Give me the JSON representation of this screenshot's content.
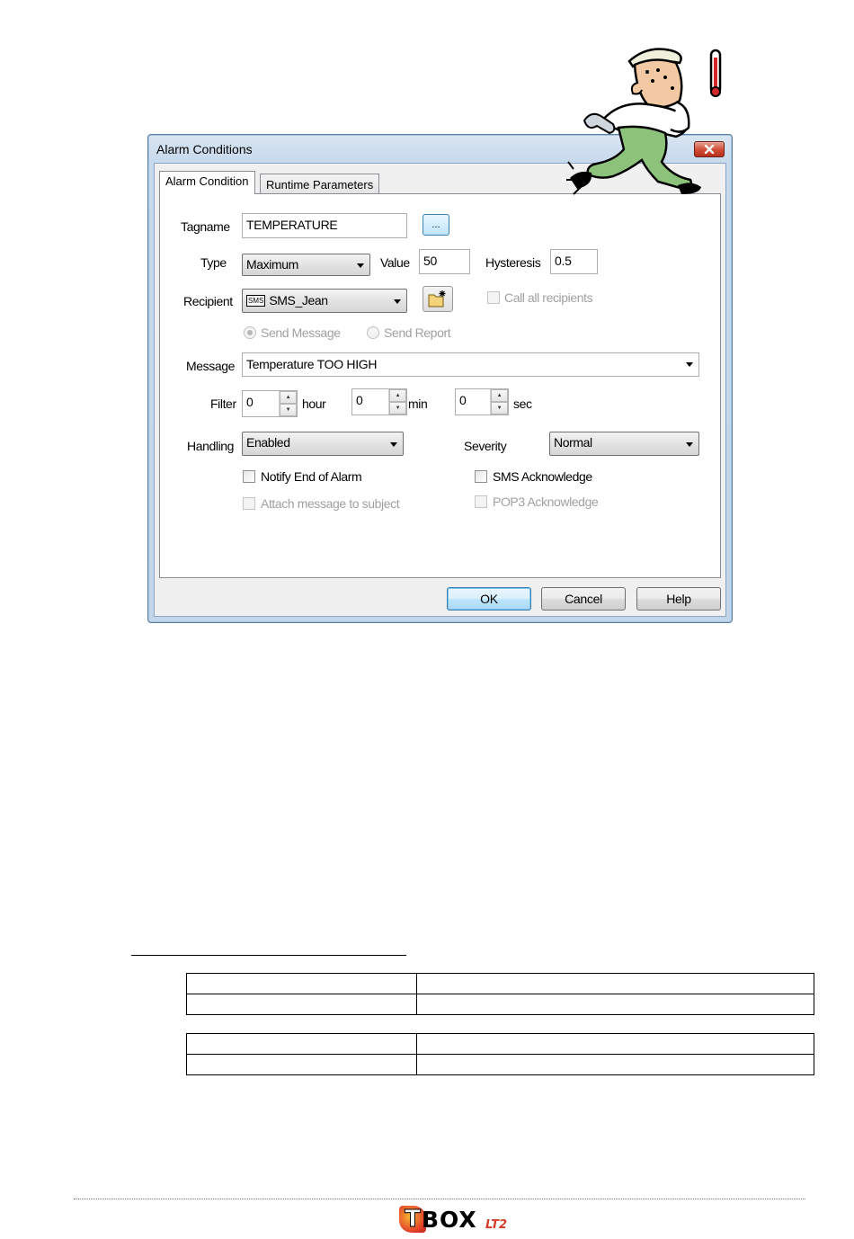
{
  "dialog": {
    "title": "Alarm Conditions",
    "tabs": [
      {
        "label": "Alarm Condition",
        "active": true
      },
      {
        "label": "Runtime Parameters",
        "active": false
      }
    ],
    "tagname": {
      "label": "Tagname",
      "value": "TEMPERATURE",
      "browse_label": "..."
    },
    "type": {
      "label": "Type",
      "value": "Maximum"
    },
    "value": {
      "label": "Value",
      "value": "50"
    },
    "hysteresis": {
      "label": "Hysteresis",
      "value": "0.5"
    },
    "recipient": {
      "label": "Recipient",
      "value": "SMS_Jean",
      "badge": "SMS"
    },
    "call_all": {
      "label": "Call all recipients",
      "checked": false,
      "enabled": false
    },
    "send_message": {
      "label": "Send Message",
      "selected": true,
      "enabled": false
    },
    "send_report": {
      "label": "Send Report",
      "selected": false,
      "enabled": false
    },
    "message": {
      "label": "Message",
      "value": "Temperature TOO HIGH"
    },
    "filter": {
      "label": "Filter",
      "hour": {
        "value": "0",
        "unit": "hour"
      },
      "min": {
        "value": "0",
        "unit": "min"
      },
      "sec": {
        "value": "0",
        "unit": "sec"
      }
    },
    "handling": {
      "label": "Handling",
      "value": "Enabled"
    },
    "severity": {
      "label": "Severity",
      "value": "Normal"
    },
    "notify_end": {
      "label": "Notify End of Alarm",
      "checked": false
    },
    "attach_message": {
      "label": "Attach message to subject",
      "checked": false,
      "enabled": false
    },
    "sms_ack": {
      "label": "SMS Acknowledge",
      "checked": false
    },
    "pop3_ack": {
      "label": "POP3 Acknowledge",
      "checked": false,
      "enabled": false
    },
    "buttons": {
      "ok": "OK",
      "cancel": "Cancel",
      "help": "Help"
    }
  },
  "footer": {
    "logo_main": "BOX",
    "logo_t": "T",
    "logo_sub": "LT2"
  },
  "colors": {
    "accent": "#3c7fb1",
    "close": "#c7412c",
    "logo_red": "#d63b2a",
    "logo_orange": "#f7b733"
  }
}
